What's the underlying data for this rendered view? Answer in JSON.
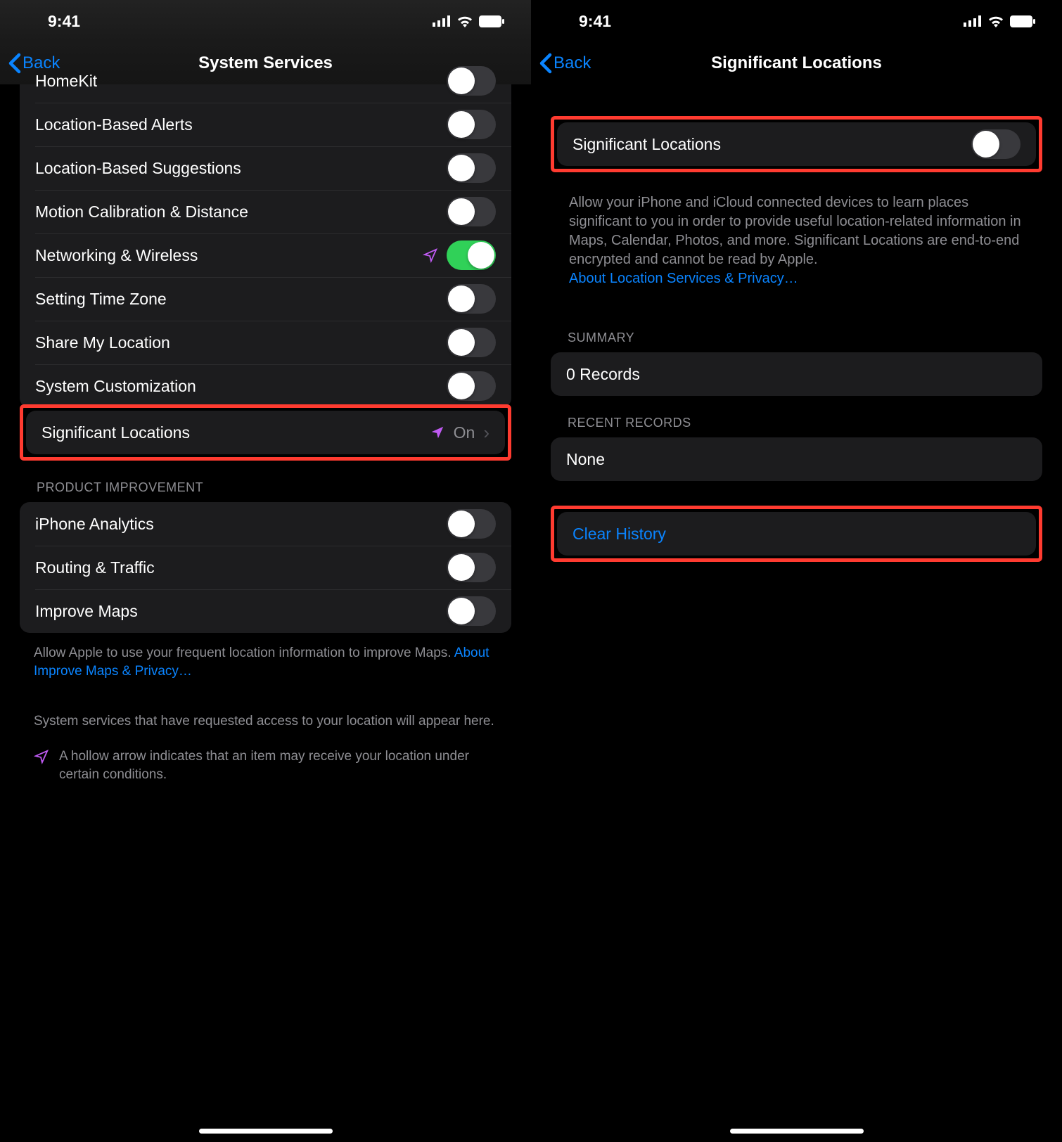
{
  "statusbar": {
    "time": "9:41"
  },
  "left": {
    "back_label": "Back",
    "title": "System Services",
    "sys_rows": [
      {
        "label": "HomeKit",
        "on": false,
        "arrow": false
      },
      {
        "label": "Location-Based Alerts",
        "on": false,
        "arrow": false
      },
      {
        "label": "Location-Based Suggestions",
        "on": false,
        "arrow": false
      },
      {
        "label": "Motion Calibration & Distance",
        "on": false,
        "arrow": false
      },
      {
        "label": "Networking & Wireless",
        "on": true,
        "arrow": true
      },
      {
        "label": "Setting Time Zone",
        "on": false,
        "arrow": false
      },
      {
        "label": "Share My Location",
        "on": false,
        "arrow": false
      },
      {
        "label": "System Customization",
        "on": false,
        "arrow": false
      }
    ],
    "sig_row": {
      "label": "Significant Locations",
      "value": "On"
    },
    "product_header": "PRODUCT IMPROVEMENT",
    "product_rows": [
      {
        "label": "iPhone Analytics",
        "on": false
      },
      {
        "label": "Routing & Traffic",
        "on": false
      },
      {
        "label": "Improve Maps",
        "on": false
      }
    ],
    "footer1_a": "Allow Apple to use your frequent location information to improve Maps. ",
    "footer1_link": "About Improve Maps & Privacy…",
    "footer2": "System services that have requested access to your location will appear here.",
    "footer3": "A hollow arrow indicates that an item may receive your location under certain conditions."
  },
  "right": {
    "back_label": "Back",
    "title": "Significant Locations",
    "toggle_label": "Significant Locations",
    "toggle_on": false,
    "desc_text": "Allow your iPhone and iCloud connected devices to learn places significant to you in order to provide useful location-related information in Maps, Calendar, Photos, and more. Significant Locations are end-to-end encrypted and cannot be read by Apple.",
    "desc_link": "About Location Services & Privacy…",
    "summary_header": "SUMMARY",
    "summary_value": "0 Records",
    "recent_header": "RECENT RECORDS",
    "recent_value": "None",
    "clear_label": "Clear History"
  }
}
